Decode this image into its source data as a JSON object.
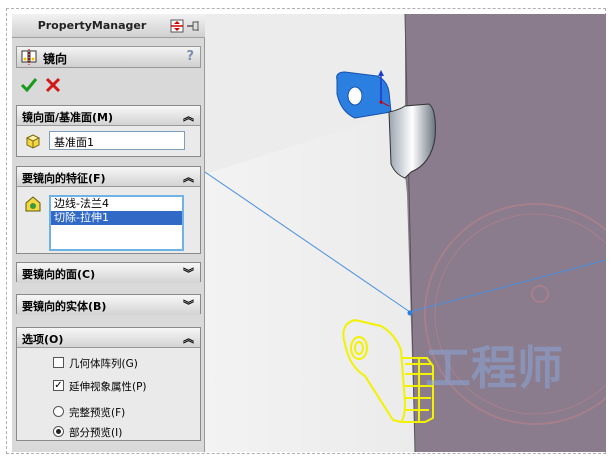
{
  "property_manager": {
    "title": "PropertyManager"
  },
  "feature": {
    "name": "镜向",
    "help": "?"
  },
  "groups": {
    "mirror_face": {
      "title": "镜向面/基准面(M)",
      "value": "基准面1"
    },
    "features": {
      "title": "要镜向的特征(F)",
      "items": [
        "边线-法兰4",
        "切除-拉伸1"
      ]
    },
    "faces": {
      "title": "要镜向的面(C)"
    },
    "bodies": {
      "title": "要镜向的实体(B)"
    },
    "options": {
      "title": "选项(O)",
      "geometry_pattern": "几何体阵列(G)",
      "propagate_visual": "延伸视象属性(P)",
      "full_preview": "完整预览(F)",
      "partial_preview": "部分预览(I)",
      "geometry_pattern_checked": false,
      "propagate_visual_checked": true,
      "selected_preview": "partial"
    }
  },
  "watermark": {
    "text": "工程师"
  },
  "colors": {
    "wall_right": "#8a7b8d",
    "selection_blue": "#2b7fe0",
    "preview_yellow": "#f2f200",
    "plane_line": "#4a8fe0"
  }
}
